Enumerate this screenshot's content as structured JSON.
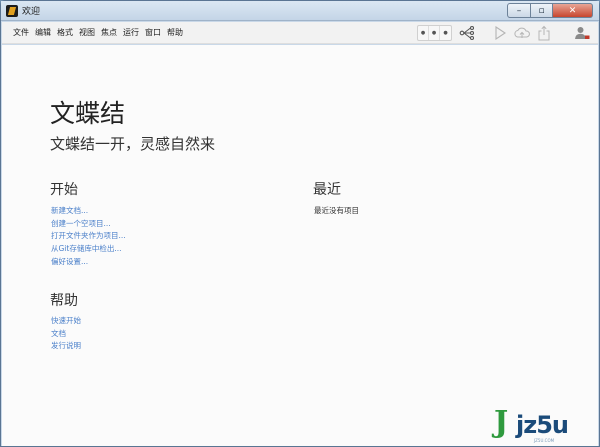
{
  "window": {
    "title": "欢迎",
    "controls": {
      "minimize": "–",
      "maximize": "▫",
      "close": "✕"
    }
  },
  "menu": [
    "文件",
    "编辑",
    "格式",
    "视图",
    "焦点",
    "运行",
    "窗口",
    "帮助"
  ],
  "toolbar": {
    "nav": [
      "●",
      "●",
      "●"
    ]
  },
  "welcome": {
    "title": "文蝶结",
    "subtitle": "文蝶结一开，灵感自然来",
    "start": {
      "heading": "开始",
      "links": [
        "新建文档...",
        "创建一个空项目...",
        "打开文件夹作为项目...",
        "从Git存储库中检出...",
        "偏好设置..."
      ]
    },
    "help": {
      "heading": "帮助",
      "links": [
        "快速开始",
        "文档",
        "发行说明"
      ]
    },
    "recent": {
      "heading": "最近",
      "empty": "最近没有项目"
    }
  },
  "watermark": {
    "mark": "J",
    "text": "jz5u",
    "url": "JZ5U.COM"
  },
  "colors": {
    "link": "#4a7fc9",
    "accent_red": "#c0392b",
    "watermark_green": "#2f9a3e",
    "watermark_blue": "#1b4b7a"
  }
}
